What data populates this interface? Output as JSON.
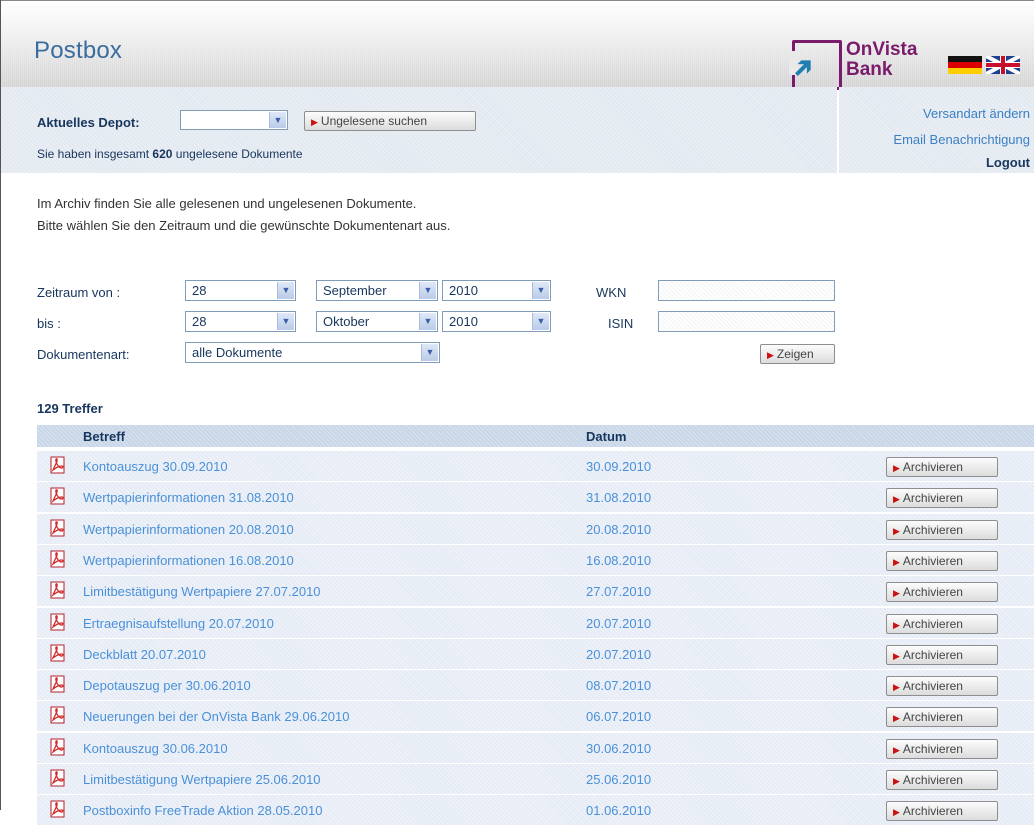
{
  "header": {
    "title": "Postbox",
    "bank_line1": "OnVista",
    "bank_line2": "Bank"
  },
  "depot": {
    "label": "Aktuelles Depot:",
    "selected": "",
    "unread_button": "Ungelesene suchen",
    "unread_prefix": "Sie haben insgesamt",
    "unread_count": "620",
    "unread_suffix": "ungelesene Dokumente"
  },
  "links": {
    "shipping": "Versandart ändern",
    "email": "Email Benachrichtigung",
    "logout": "Logout"
  },
  "intro": {
    "line1": "Im Archiv finden Sie alle gelesenen und ungelesenen Dokumente.",
    "line2": "Bitte wählen Sie den Zeitraum und die gewünschte Dokumentenart aus."
  },
  "filter": {
    "from_label": "Zeitraum von :",
    "to_label": "bis :",
    "type_label": "Dokumentenart:",
    "from_day": "28",
    "from_month": "September",
    "from_year": "2010",
    "to_day": "28",
    "to_month": "Oktober",
    "to_year": "2010",
    "doc_type": "alle Dokumente",
    "wkn_label": "WKN",
    "wkn_value": "",
    "isin_label": "ISIN",
    "isin_value": "",
    "show_button": "Zeigen"
  },
  "results": {
    "hits": "129 Treffer",
    "col_subject": "Betreff",
    "col_date": "Datum",
    "archive_label": "Archivieren",
    "rows": [
      {
        "subject": "Kontoauszug 30.09.2010",
        "date": "30.09.2010"
      },
      {
        "subject": "Wertpapierinformationen 31.08.2010",
        "date": "31.08.2010"
      },
      {
        "subject": "Wertpapierinformationen 20.08.2010",
        "date": "20.08.2010"
      },
      {
        "subject": "Wertpapierinformationen 16.08.2010",
        "date": "16.08.2010"
      },
      {
        "subject": "Limitbestätigung Wertpapiere 27.07.2010",
        "date": "27.07.2010"
      },
      {
        "subject": "Ertraegnisaufstellung 20.07.2010",
        "date": "20.07.2010"
      },
      {
        "subject": "Deckblatt 20.07.2010",
        "date": "20.07.2010"
      },
      {
        "subject": "Depotauszug per 30.06.2010",
        "date": "08.07.2010"
      },
      {
        "subject": "Neuerungen bei der OnVista Bank 29.06.2010",
        "date": "06.07.2010"
      },
      {
        "subject": "Kontoauszug 30.06.2010",
        "date": "30.06.2010"
      },
      {
        "subject": "Limitbestätigung Wertpapiere 25.06.2010",
        "date": "25.06.2010"
      },
      {
        "subject": "Postboxinfo FreeTrade Aktion 28.05.2010",
        "date": "01.06.2010"
      }
    ]
  }
}
